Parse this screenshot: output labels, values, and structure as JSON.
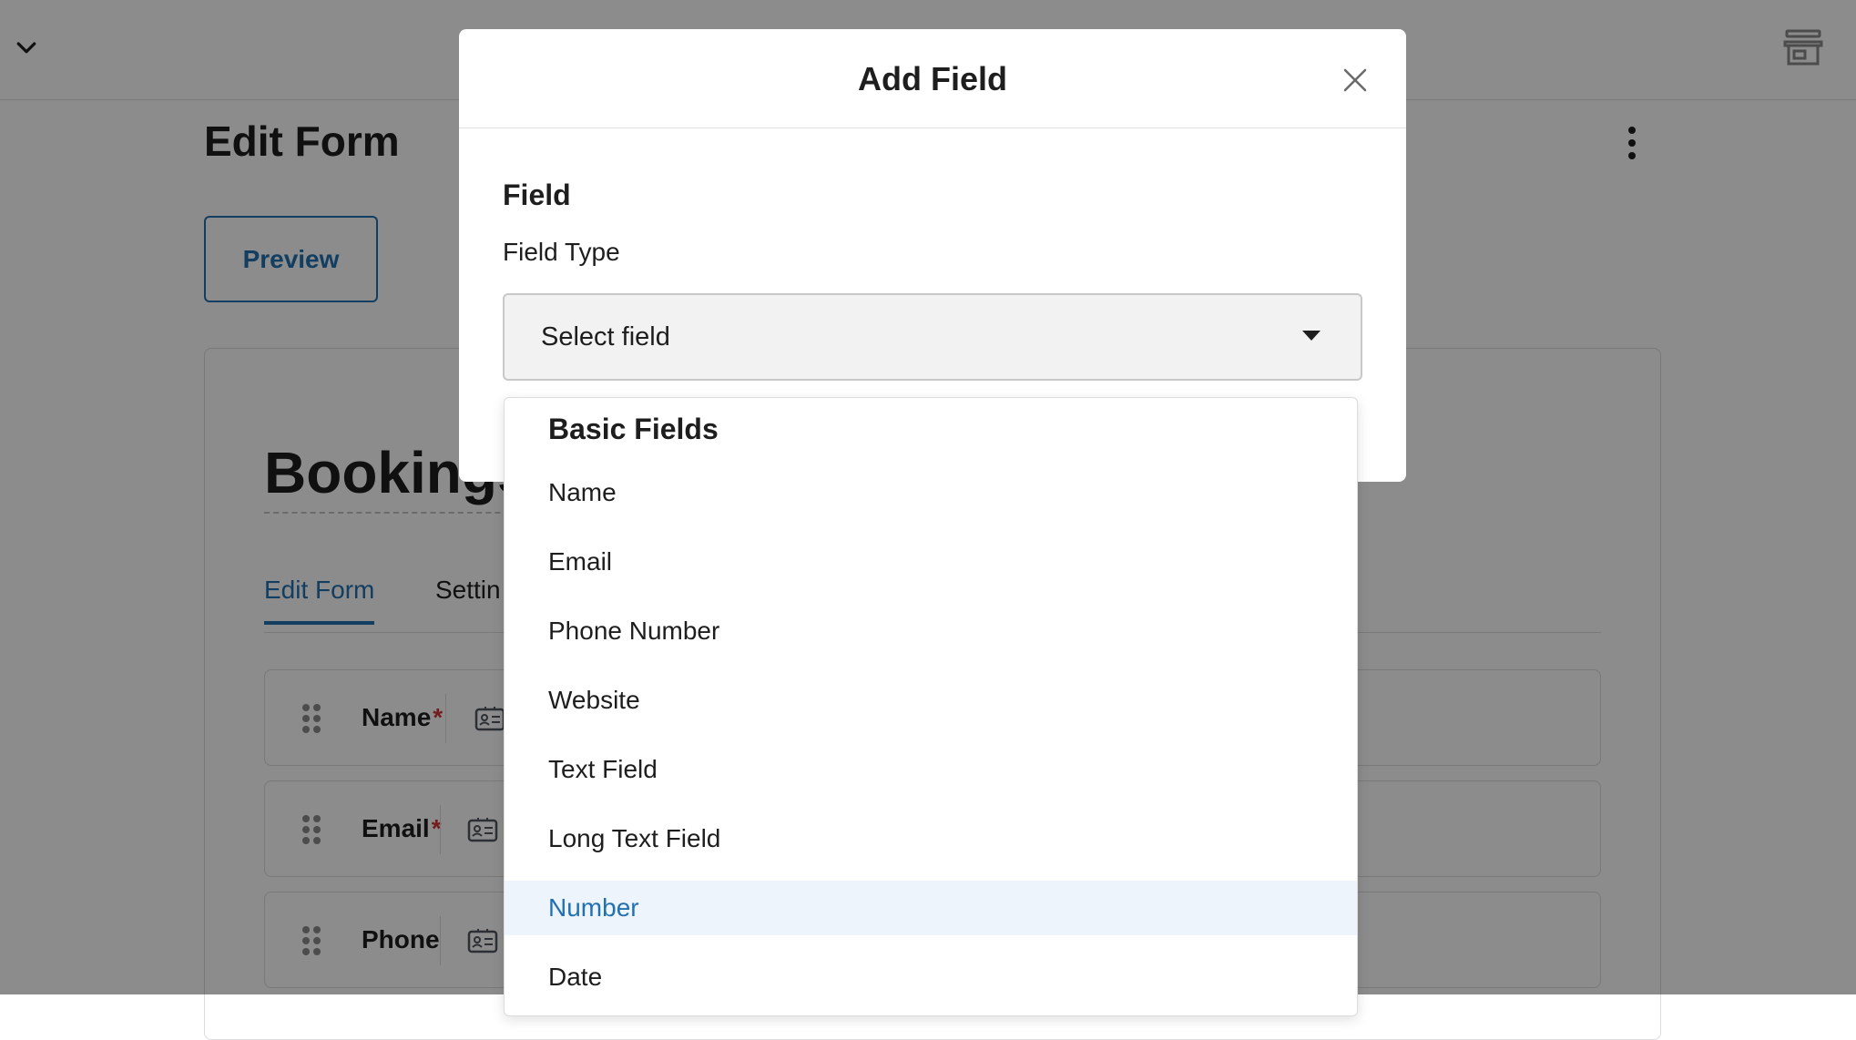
{
  "background": {
    "page_title": "Edit Form",
    "preview_label": "Preview",
    "form_title": "Bookings",
    "tabs": [
      {
        "label": "Edit Form"
      },
      {
        "label": "Settin"
      }
    ],
    "fields": [
      {
        "label": "Name",
        "required": "*"
      },
      {
        "label": "Email",
        "required": "*"
      },
      {
        "label": "Phone",
        "required": ""
      }
    ]
  },
  "modal": {
    "title": "Add Field",
    "section_label": "Field",
    "field_type_label": "Field Type",
    "select_value": "Select field"
  },
  "dropdown": {
    "group_label": "Basic Fields",
    "items": [
      {
        "label": "Name"
      },
      {
        "label": "Email"
      },
      {
        "label": "Phone Number"
      },
      {
        "label": "Website"
      },
      {
        "label": "Text Field"
      },
      {
        "label": "Long Text Field"
      },
      {
        "label": "Number"
      },
      {
        "label": "Date"
      }
    ],
    "highlighted_item": "Number"
  },
  "colors": {
    "accent": "#2271b1",
    "required": "#d63638",
    "highlight_bg": "#eef4fb"
  },
  "icons": [
    "chevron-down-icon",
    "store-icon",
    "more-vertical-icon",
    "close-icon",
    "drag-handle-icon",
    "id-card-icon",
    "caret-down-icon"
  ]
}
